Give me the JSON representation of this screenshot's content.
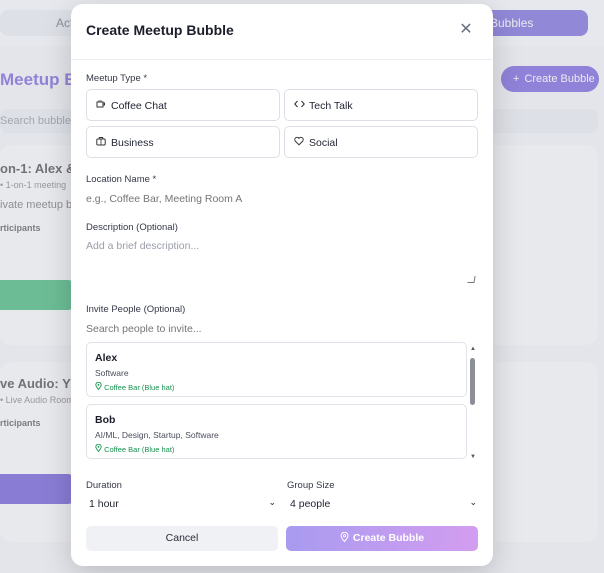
{
  "background": {
    "tab_left": "Act",
    "tab_right": "Bubbles",
    "title": "Meetup Bu",
    "create_button": "Create Bubble",
    "search_placeholder": "Search bubbles.",
    "card1": {
      "title": "on-1: Alex &",
      "subtitle": "1-on-1 meeting",
      "description": "ivate meetup be",
      "participants": "rticipants"
    },
    "card2": {
      "title": "ve Audio: YC",
      "subtitle": "Live Audio Room",
      "participants": "rticipants"
    }
  },
  "modal": {
    "title": "Create Meetup Bubble",
    "close_icon": "close-icon",
    "meetup_type_label": "Meetup Type *",
    "meetup_types": [
      {
        "label": "Coffee Chat",
        "icon": "coffee-icon"
      },
      {
        "label": "Tech Talk",
        "icon": "code-icon"
      },
      {
        "label": "Business",
        "icon": "briefcase-icon"
      },
      {
        "label": "Social",
        "icon": "heart-icon"
      }
    ],
    "location_label": "Location Name *",
    "location_placeholder": "e.g., Coffee Bar, Meeting Room A",
    "description_label": "Description (Optional)",
    "description_placeholder": "Add a brief description...",
    "invite_label": "Invite People (Optional)",
    "invite_placeholder": "Search people to invite...",
    "people": [
      {
        "name": "Alex",
        "tags": "Software",
        "location": "Coffee Bar (Blue hat)"
      },
      {
        "name": "Bob",
        "tags": "AI/ML, Design, Startup, Software",
        "location": "Coffee Bar (Blue hat)"
      }
    ],
    "duration_label": "Duration",
    "duration_value": "1 hour",
    "group_size_label": "Group Size",
    "group_size_value": "4 people",
    "cancel_label": "Cancel",
    "create_label": "Create Bubble"
  },
  "colors": {
    "accent_purple": "#5a3ed6",
    "green": "#18a95e",
    "location_green": "#17914f",
    "create_gradient_start": "#a89bf0",
    "create_gradient_end": "#d39df0"
  }
}
